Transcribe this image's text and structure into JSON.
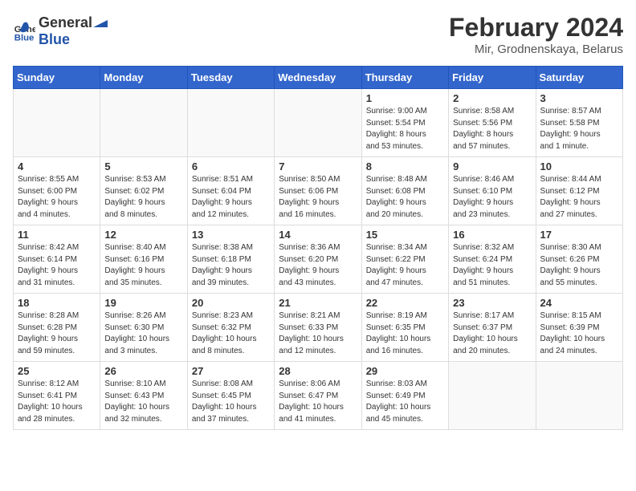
{
  "header": {
    "logo_general": "General",
    "logo_blue": "Blue",
    "month_year": "February 2024",
    "location": "Mir, Grodnenskaya, Belarus"
  },
  "weekdays": [
    "Sunday",
    "Monday",
    "Tuesday",
    "Wednesday",
    "Thursday",
    "Friday",
    "Saturday"
  ],
  "weeks": [
    [
      {
        "day": "",
        "info": ""
      },
      {
        "day": "",
        "info": ""
      },
      {
        "day": "",
        "info": ""
      },
      {
        "day": "",
        "info": ""
      },
      {
        "day": "1",
        "info": "Sunrise: 9:00 AM\nSunset: 5:54 PM\nDaylight: 8 hours\nand 53 minutes."
      },
      {
        "day": "2",
        "info": "Sunrise: 8:58 AM\nSunset: 5:56 PM\nDaylight: 8 hours\nand 57 minutes."
      },
      {
        "day": "3",
        "info": "Sunrise: 8:57 AM\nSunset: 5:58 PM\nDaylight: 9 hours\nand 1 minute."
      }
    ],
    [
      {
        "day": "4",
        "info": "Sunrise: 8:55 AM\nSunset: 6:00 PM\nDaylight: 9 hours\nand 4 minutes."
      },
      {
        "day": "5",
        "info": "Sunrise: 8:53 AM\nSunset: 6:02 PM\nDaylight: 9 hours\nand 8 minutes."
      },
      {
        "day": "6",
        "info": "Sunrise: 8:51 AM\nSunset: 6:04 PM\nDaylight: 9 hours\nand 12 minutes."
      },
      {
        "day": "7",
        "info": "Sunrise: 8:50 AM\nSunset: 6:06 PM\nDaylight: 9 hours\nand 16 minutes."
      },
      {
        "day": "8",
        "info": "Sunrise: 8:48 AM\nSunset: 6:08 PM\nDaylight: 9 hours\nand 20 minutes."
      },
      {
        "day": "9",
        "info": "Sunrise: 8:46 AM\nSunset: 6:10 PM\nDaylight: 9 hours\nand 23 minutes."
      },
      {
        "day": "10",
        "info": "Sunrise: 8:44 AM\nSunset: 6:12 PM\nDaylight: 9 hours\nand 27 minutes."
      }
    ],
    [
      {
        "day": "11",
        "info": "Sunrise: 8:42 AM\nSunset: 6:14 PM\nDaylight: 9 hours\nand 31 minutes."
      },
      {
        "day": "12",
        "info": "Sunrise: 8:40 AM\nSunset: 6:16 PM\nDaylight: 9 hours\nand 35 minutes."
      },
      {
        "day": "13",
        "info": "Sunrise: 8:38 AM\nSunset: 6:18 PM\nDaylight: 9 hours\nand 39 minutes."
      },
      {
        "day": "14",
        "info": "Sunrise: 8:36 AM\nSunset: 6:20 PM\nDaylight: 9 hours\nand 43 minutes."
      },
      {
        "day": "15",
        "info": "Sunrise: 8:34 AM\nSunset: 6:22 PM\nDaylight: 9 hours\nand 47 minutes."
      },
      {
        "day": "16",
        "info": "Sunrise: 8:32 AM\nSunset: 6:24 PM\nDaylight: 9 hours\nand 51 minutes."
      },
      {
        "day": "17",
        "info": "Sunrise: 8:30 AM\nSunset: 6:26 PM\nDaylight: 9 hours\nand 55 minutes."
      }
    ],
    [
      {
        "day": "18",
        "info": "Sunrise: 8:28 AM\nSunset: 6:28 PM\nDaylight: 9 hours\nand 59 minutes."
      },
      {
        "day": "19",
        "info": "Sunrise: 8:26 AM\nSunset: 6:30 PM\nDaylight: 10 hours\nand 3 minutes."
      },
      {
        "day": "20",
        "info": "Sunrise: 8:23 AM\nSunset: 6:32 PM\nDaylight: 10 hours\nand 8 minutes."
      },
      {
        "day": "21",
        "info": "Sunrise: 8:21 AM\nSunset: 6:33 PM\nDaylight: 10 hours\nand 12 minutes."
      },
      {
        "day": "22",
        "info": "Sunrise: 8:19 AM\nSunset: 6:35 PM\nDaylight: 10 hours\nand 16 minutes."
      },
      {
        "day": "23",
        "info": "Sunrise: 8:17 AM\nSunset: 6:37 PM\nDaylight: 10 hours\nand 20 minutes."
      },
      {
        "day": "24",
        "info": "Sunrise: 8:15 AM\nSunset: 6:39 PM\nDaylight: 10 hours\nand 24 minutes."
      }
    ],
    [
      {
        "day": "25",
        "info": "Sunrise: 8:12 AM\nSunset: 6:41 PM\nDaylight: 10 hours\nand 28 minutes."
      },
      {
        "day": "26",
        "info": "Sunrise: 8:10 AM\nSunset: 6:43 PM\nDaylight: 10 hours\nand 32 minutes."
      },
      {
        "day": "27",
        "info": "Sunrise: 8:08 AM\nSunset: 6:45 PM\nDaylight: 10 hours\nand 37 minutes."
      },
      {
        "day": "28",
        "info": "Sunrise: 8:06 AM\nSunset: 6:47 PM\nDaylight: 10 hours\nand 41 minutes."
      },
      {
        "day": "29",
        "info": "Sunrise: 8:03 AM\nSunset: 6:49 PM\nDaylight: 10 hours\nand 45 minutes."
      },
      {
        "day": "",
        "info": ""
      },
      {
        "day": "",
        "info": ""
      }
    ]
  ]
}
